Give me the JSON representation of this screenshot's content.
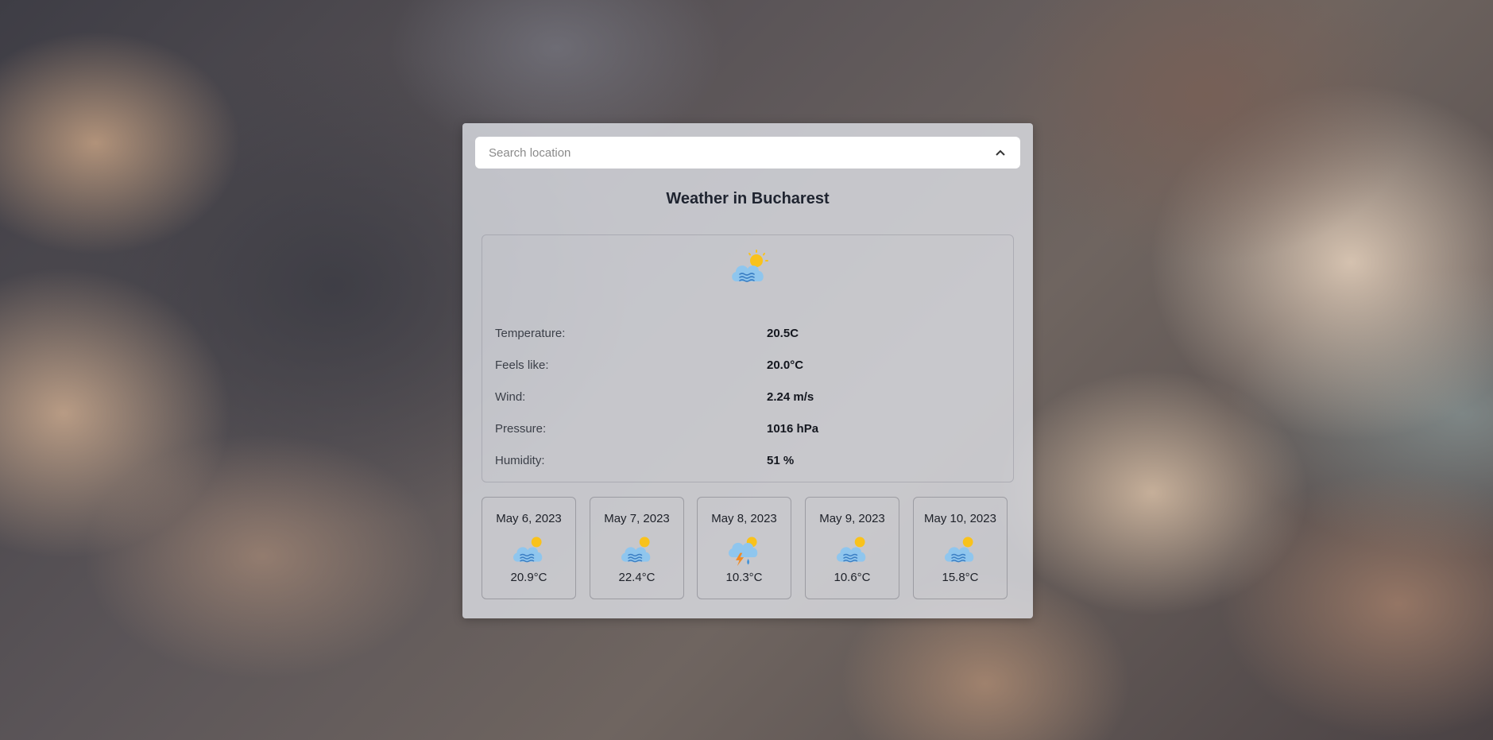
{
  "search": {
    "placeholder": "Search location"
  },
  "weather": {
    "title": "Weather in Bucharest",
    "icon": "cloud-sun-fog-icon",
    "details": [
      {
        "label": "Temperature:",
        "value": "20.5C"
      },
      {
        "label": "Feels like:",
        "value": "20.0°C"
      },
      {
        "label": "Wind:",
        "value": "2.24 m/s"
      },
      {
        "label": "Pressure:",
        "value": "1016 hPa"
      },
      {
        "label": "Humidity:",
        "value": "51 %"
      }
    ]
  },
  "forecast": [
    {
      "date": "May 6, 2023",
      "temp": "20.9°C",
      "icon": "cloud-sun-fog-icon"
    },
    {
      "date": "May 7, 2023",
      "temp": "22.4°C",
      "icon": "cloud-sun-fog-icon"
    },
    {
      "date": "May 8, 2023",
      "temp": "10.3°C",
      "icon": "cloud-sun-thunder-rain-icon"
    },
    {
      "date": "May 9, 2023",
      "temp": "10.6°C",
      "icon": "cloud-sun-fog-icon"
    },
    {
      "date": "May 10, 2023",
      "temp": "15.8°C",
      "icon": "cloud-sun-fog-icon"
    }
  ],
  "colors": {
    "sun": "#f9c21b",
    "cloud": "#8fc6ee",
    "fog_lines": "#3b7fc4",
    "bolt": "#f08a24",
    "rain": "#3a8fd8"
  }
}
